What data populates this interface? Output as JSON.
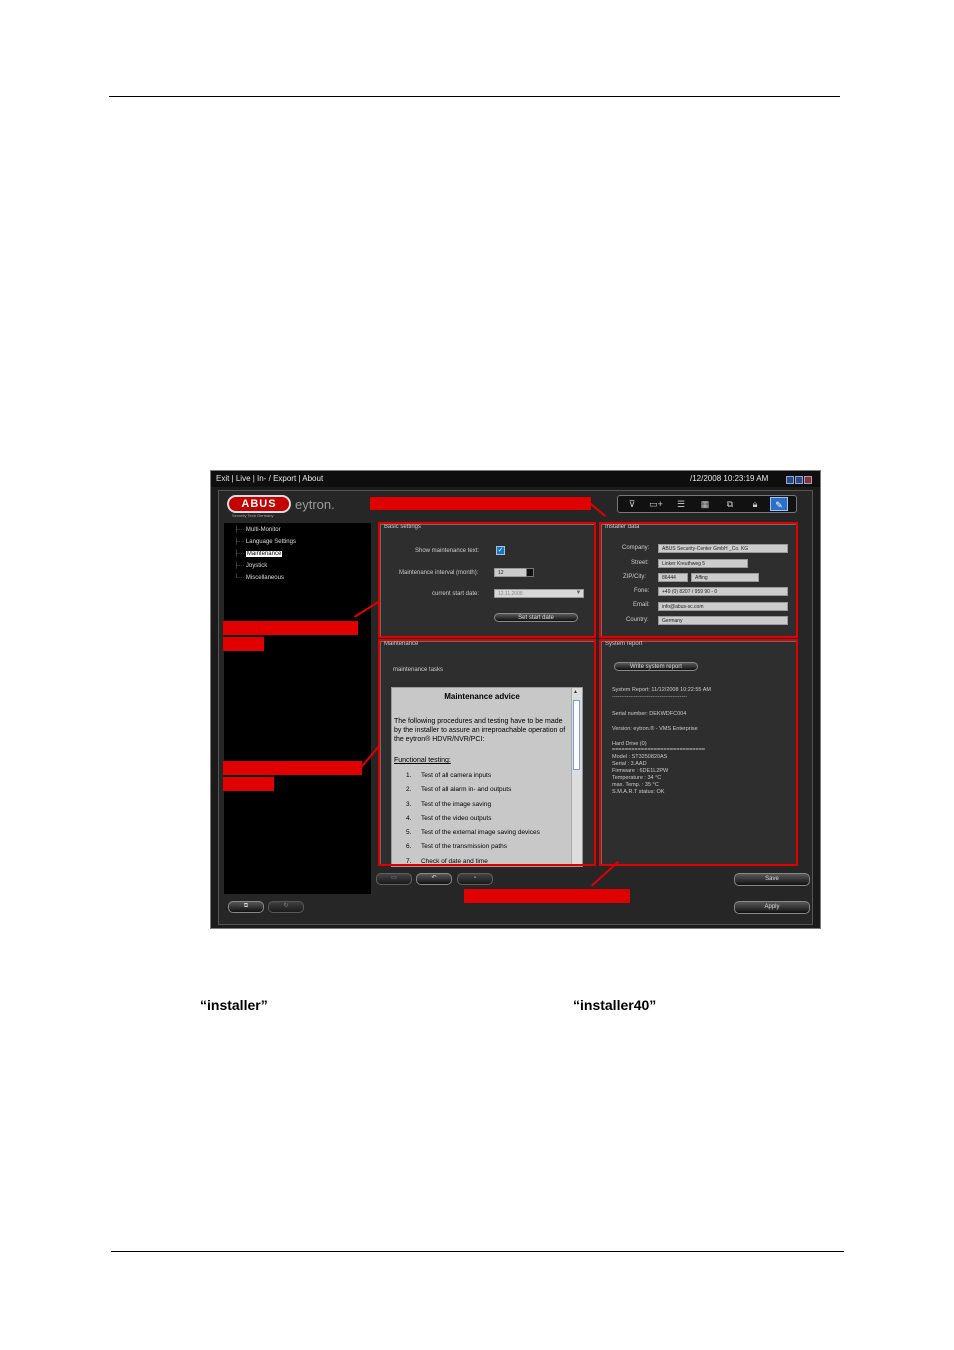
{
  "menubar": {
    "items": "Exit | Live | In- / Export | About",
    "clock": "/12/2008 10:23:19 AM"
  },
  "brand": {
    "logo": "ABUS",
    "tagline": "Security Tech Germany",
    "product": "eytron."
  },
  "toolbar": {
    "icons": [
      "playback-icon",
      "camera-add-icon",
      "list-icon",
      "grid-icon",
      "network-icon",
      "lock-icon",
      "tools-icon"
    ],
    "active_index": 6
  },
  "tree": {
    "items": [
      "Multi-Monitor",
      "Language Settings",
      "Maintenance",
      "Joystick",
      "Miscellaneous"
    ],
    "selected": "Maintenance"
  },
  "basic_settings": {
    "title": "Basic settings",
    "show_text_label": "Show maintenance text:",
    "show_text_checked": true,
    "interval_label": "Maintenance interval (month):",
    "interval_value": "12",
    "start_label": "current start date:",
    "start_value": "12.11.2008",
    "set_button": "Set start date"
  },
  "installer": {
    "title": "Installer data",
    "fields": [
      {
        "label": "Company:",
        "value": "ABUS Security-Center GmbH _Co. KG"
      },
      {
        "label": "Street:",
        "value": "Linker Kreuthweg 5"
      },
      {
        "label": "ZIP/City:",
        "value": "86444",
        "value2": "Affing"
      },
      {
        "label": "Fone:",
        "value": "+49 (0) 8207 / 959 90 - 0"
      },
      {
        "label": "Email:",
        "value": "info@abus-sc.com"
      },
      {
        "label": "Country:",
        "value": "Germany"
      }
    ]
  },
  "maintenance": {
    "title": "Maintenance",
    "tasks_label": "maintenance tasks",
    "advice_title": "Maintenance advice",
    "advice_intro": "The following procedures and testing have to be made by the installer to assure an irreproachable operation of the eytron® HDVR/NVR/PCI:",
    "functional_label": "Functional testing:",
    "steps": [
      "Test of all camera inputs",
      "Test of all alarm in- and outputs",
      "Test of the image saving",
      "Test of the video outputs",
      "Test of the external image saving devices",
      "Test of the transmission paths",
      "Check of date and time"
    ]
  },
  "report": {
    "title": "System report",
    "button": "Write system report",
    "lines": [
      "System Report: 11/12/2008 10:22:55 AM",
      "-----------------------------------------",
      "",
      "Serial number: DEKWDFC004",
      "",
      "Version:     eytron.® - VMS Enterprise",
      "",
      "Hard Drive (0)",
      "=============================",
      "Model       : ST3250820AS",
      "Serial      : 3.AAD",
      "Firmware    : 6DE1L2PW",
      "Temperature : 34 °C",
      "max. Temp.  : 35 °C",
      "S.M.A.R.T status: OK"
    ]
  },
  "bottom": {
    "save": "Save",
    "apply": "Apply"
  },
  "captions": {
    "left": "“installer”",
    "right": "“installer40”"
  }
}
